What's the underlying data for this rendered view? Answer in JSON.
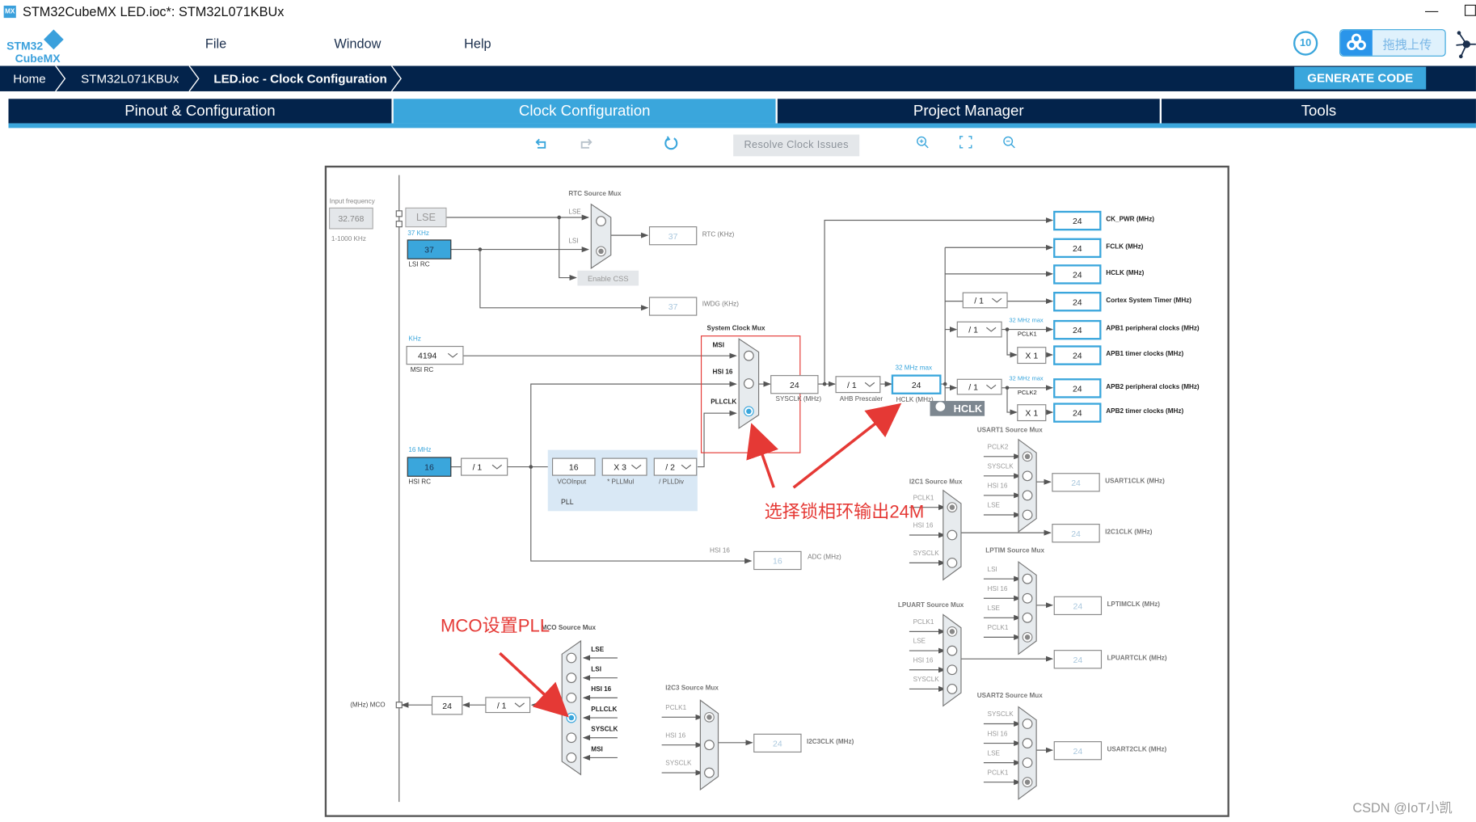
{
  "window": {
    "app_badge": "MX",
    "title": "STM32CubeMX LED.ioc*: STM32L071KBUx",
    "minimize": "—"
  },
  "logo": {
    "line1": "STM32",
    "line2": "CubeMX"
  },
  "menu": {
    "file": "File",
    "window": "Window",
    "help": "Help"
  },
  "right_icons": {
    "badge_text": "10",
    "upload_label": "拖拽上传"
  },
  "breadcrumb": [
    {
      "label": "Home"
    },
    {
      "label": "STM32L071KBUx"
    },
    {
      "label": "LED.ioc - Clock Configuration"
    }
  ],
  "generate_code": "GENERATE CODE",
  "tabs": [
    {
      "label": "Pinout & Configuration",
      "active": false
    },
    {
      "label": "Clock Configuration",
      "active": true
    },
    {
      "label": "Project Manager",
      "active": false
    },
    {
      "label": "Tools",
      "active": false
    }
  ],
  "toolbar": {
    "resolve": "Resolve Clock Issues",
    "undo": "undo-icon",
    "redo": "redo-icon",
    "refresh": "refresh-icon",
    "zoom_in": "zoom-in-icon",
    "fit": "fit-icon",
    "zoom_out": "zoom-out-icon"
  },
  "colors": {
    "accent": "#3aa6dc",
    "navy": "#03234b",
    "annotation": "#e53935"
  },
  "diagram": {
    "input_frequency_label": "Input frequency",
    "lse_input": "32.768",
    "lse_range": "1-1000 KHz",
    "lse_label": "LSE",
    "lsi_unit": "37 KHz",
    "lsi_value": "37",
    "lsi_label": "LSI RC",
    "rtc_mux_title": "RTC Source Mux",
    "rtc_mux_inputs": [
      "LSE",
      "LSI"
    ],
    "enable_css": "Enable CSS",
    "rtc_value": "37",
    "rtc_label": "RTC (KHz)",
    "iwdg_value": "37",
    "iwdg_label": "IWDG (KHz)",
    "msi_unit": "KHz",
    "msi_value": "4194",
    "msi_label": "MSI RC",
    "hsi_unit": "16 MHz",
    "hsi_value": "16",
    "hsi_label": "HSI RC",
    "hsi_div": "/ 1",
    "pll": {
      "vco_value": "16",
      "vco_label": "VCOInput",
      "mul_value": "X 3",
      "mul_label": "* PLLMul",
      "div_value": "/ 2",
      "div_label": "/ PLLDiv",
      "title": "PLL"
    },
    "sysclk_mux_title": "System Clock Mux",
    "sysclk_mux_inputs": [
      "MSI",
      "HSI 16",
      "PLLCLK"
    ],
    "sysclk_selected": "PLLCLK",
    "sysclk_value": "24",
    "sysclk_label": "SYSCLK (MHz)",
    "ahb_value": "/ 1",
    "ahb_label": "AHB Prescaler",
    "hclk_max": "32 MHz max",
    "hclk_value": "24",
    "hclk_label": "HCLK (MHz)",
    "hclk_tooltip": "HCLK",
    "outputs": [
      {
        "value": "24",
        "label": "CK_PWR (MHz)"
      },
      {
        "value": "24",
        "label": "FCLK (MHz)"
      },
      {
        "value": "24",
        "label": "HCLK (MHz)"
      },
      {
        "value": "24",
        "label": "Cortex System Timer (MHz)",
        "prescaler": "/ 1"
      },
      {
        "value": "24",
        "label": "APB1 peripheral clocks (MHz)",
        "prescaler": "/ 1",
        "max": "32 MHz max",
        "bus": "PCLK1"
      },
      {
        "value": "24",
        "label": "APB1 timer clocks (MHz)",
        "mult": "X 1"
      },
      {
        "value": "24",
        "label": "APB2 peripheral clocks (MHz)",
        "prescaler": "/ 1",
        "max": "32 MHz max",
        "bus": "PCLK2"
      },
      {
        "value": "24",
        "label": "APB2 timer clocks (MHz)",
        "mult": "X 1"
      }
    ],
    "adc": {
      "input": "HSI 16",
      "value": "16",
      "label": "ADC (MHz)"
    },
    "usart1": {
      "title": "USART1 Source Mux",
      "inputs": [
        "PCLK2",
        "SYSCLK",
        "HSI 16",
        "LSE"
      ],
      "selected": 0,
      "value": "24",
      "label": "USART1CLK (MHz)"
    },
    "i2c1": {
      "title": "I2C1 Source Mux",
      "inputs": [
        "PCLK1",
        "HSI 16",
        "SYSCLK"
      ],
      "selected": 0,
      "value": "24",
      "label": "I2C1CLK (MHz)"
    },
    "lptim": {
      "title": "LPTIM Source Mux",
      "inputs": [
        "LSI",
        "HSI 16",
        "LSE",
        "PCLK1"
      ],
      "selected": 3,
      "value": "24",
      "label": "LPTIMCLK (MHz)"
    },
    "lpuart": {
      "title": "LPUART Source Mux",
      "inputs": [
        "PCLK1",
        "LSE",
        "HSI 16",
        "SYSCLK"
      ],
      "selected": 0,
      "value": "24",
      "label": "LPUARTCLK (MHz)"
    },
    "usart2": {
      "title": "USART2 Source Mux",
      "inputs": [
        "SYSCLK",
        "HSI 16",
        "LSE",
        "PCLK1"
      ],
      "selected": 3,
      "value": "24",
      "label": "USART2CLK (MHz)"
    },
    "i2c3": {
      "title": "I2C3 Source Mux",
      "inputs": [
        "PCLK1",
        "HSI 16",
        "SYSCLK"
      ],
      "selected": 0,
      "value": "24",
      "label": "I2C3CLK (MHz)"
    },
    "mco": {
      "title": "MCO Source Mux",
      "inputs": [
        "LSE",
        "LSI",
        "HSI 16",
        "PLLCLK",
        "SYSCLK",
        "MSI"
      ],
      "selected": 3,
      "div": "/ 1",
      "value": "24",
      "label": "(MHz) MCO"
    },
    "annotations": {
      "pll_note": "选择锁相环输出24M",
      "mco_note": "MCO设置PLL"
    }
  },
  "watermark": "CSDN @IoT小凯"
}
